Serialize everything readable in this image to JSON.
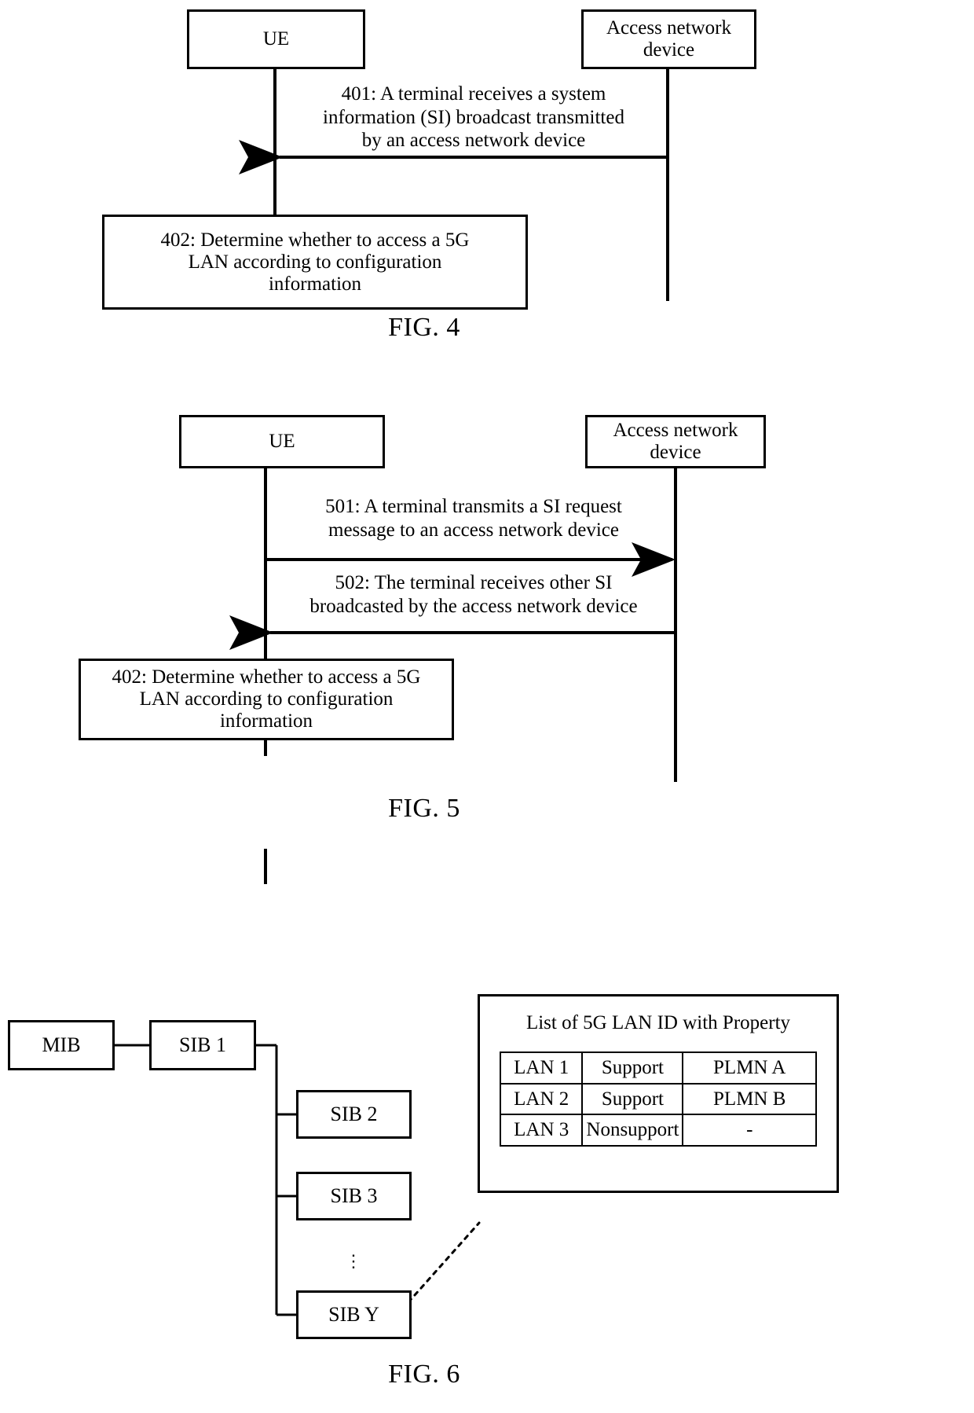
{
  "figures": [
    {
      "id": "fig4",
      "caption": "FIG. 4",
      "actors": [
        {
          "name": "ue",
          "label": "UE"
        },
        {
          "name": "access-network-device",
          "label": "Access network\ndevice"
        }
      ],
      "messages": [
        {
          "name": "message-401",
          "label": "401: A terminal receives a system\ninformation (SI) broadcast transmitted\nby an access network device",
          "direction": "right-to-left"
        }
      ],
      "steps": [
        {
          "name": "step-402",
          "label": "402: Determine whether to access a 5G\nLAN according to configuration\ninformation"
        }
      ]
    },
    {
      "id": "fig5",
      "caption": "FIG. 5",
      "actors": [
        {
          "name": "ue",
          "label": "UE"
        },
        {
          "name": "access-network-device",
          "label": "Access network\ndevice"
        }
      ],
      "messages": [
        {
          "name": "message-501",
          "label": "501: A terminal transmits a SI request\nmessage to an access network device",
          "direction": "left-to-right"
        },
        {
          "name": "message-502",
          "label": "502: The terminal receives other SI\nbroadcasted by the access network device",
          "direction": "right-to-left"
        }
      ],
      "steps": [
        {
          "name": "step-402",
          "label": "402: Determine whether to access a 5G\nLAN according to configuration\ninformation"
        }
      ]
    },
    {
      "id": "fig6",
      "caption": "FIG. 6",
      "tree": {
        "root": {
          "name": "mib",
          "label": "MIB"
        },
        "second": {
          "name": "sib-1",
          "label": "SIB 1"
        },
        "children": [
          {
            "name": "sib-2",
            "label": "SIB 2"
          },
          {
            "name": "sib-3",
            "label": "SIB 3"
          },
          {
            "name": "sib-y",
            "label": "SIB Y"
          }
        ],
        "ellipsis": "⋮"
      },
      "detail_panel": {
        "title": "List of 5G LAN ID with Property",
        "columns": [
          "lan-id",
          "support-status",
          "plmn"
        ],
        "rows": [
          [
            "LAN 1",
            "Support",
            "PLMN A"
          ],
          [
            "LAN 2",
            "Support",
            "PLMN B"
          ],
          [
            "LAN 3",
            "Nonsupport",
            "-"
          ]
        ]
      }
    }
  ],
  "colors": {
    "line": "#000000",
    "background": "#ffffff"
  }
}
